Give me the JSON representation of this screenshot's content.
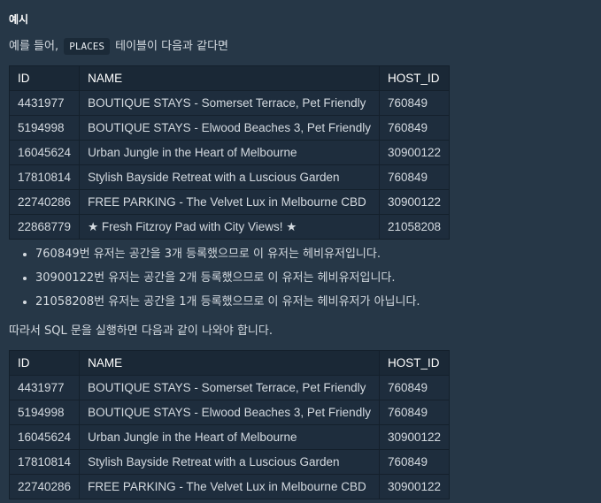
{
  "heading": "예시",
  "intro": {
    "before": "예를 들어,",
    "code": "PLACES",
    "after": "테이블이 다음과 같다면"
  },
  "table1": {
    "headers": [
      "ID",
      "NAME",
      "HOST_ID"
    ],
    "rows": [
      [
        "4431977",
        "BOUTIQUE STAYS - Somerset Terrace, Pet Friendly",
        "760849"
      ],
      [
        "5194998",
        "BOUTIQUE STAYS - Elwood Beaches 3, Pet Friendly",
        "760849"
      ],
      [
        "16045624",
        "Urban Jungle in the Heart of Melbourne",
        "30900122"
      ],
      [
        "17810814",
        "Stylish Bayside Retreat with a Luscious Garden",
        "760849"
      ],
      [
        "22740286",
        "FREE PARKING - The Velvet Lux in Melbourne CBD",
        "30900122"
      ],
      [
        "22868779",
        "★ Fresh Fitzroy Pad with City Views! ★",
        "21058208"
      ]
    ]
  },
  "bullets": [
    "760849번 유저는 공간을 3개 등록했으므로 이 유저는 헤비유저입니다.",
    "30900122번 유저는 공간을 2개 등록했으므로 이 유저는 헤비유저입니다.",
    "21058208번 유저는 공간을 1개 등록했으므로 이 유저는 헤비유저가 아닙니다."
  ],
  "conclusion": "따라서 SQL 문을 실행하면 다음과 같이 나와야 합니다.",
  "table2": {
    "headers": [
      "ID",
      "NAME",
      "HOST_ID"
    ],
    "rows": [
      [
        "4431977",
        "BOUTIQUE STAYS - Somerset Terrace, Pet Friendly",
        "760849"
      ],
      [
        "5194998",
        "BOUTIQUE STAYS - Elwood Beaches 3, Pet Friendly",
        "760849"
      ],
      [
        "16045624",
        "Urban Jungle in the Heart of Melbourne",
        "30900122"
      ],
      [
        "17810814",
        "Stylish Bayside Retreat with a Luscious Garden",
        "760849"
      ],
      [
        "22740286",
        "FREE PARKING - The Velvet Lux in Melbourne CBD",
        "30900122"
      ]
    ]
  }
}
